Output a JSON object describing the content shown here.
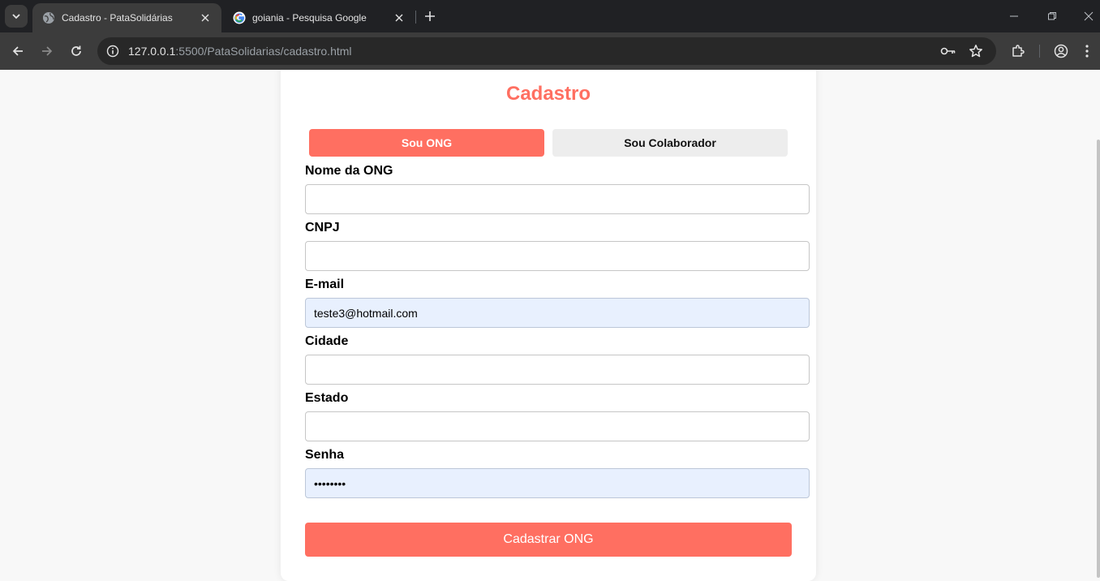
{
  "browser": {
    "tabs": [
      {
        "title": "Cadastro - PataSolidárias",
        "active": true
      },
      {
        "title": "goiania - Pesquisa Google",
        "active": false
      }
    ],
    "url_host": "127.0.0.1",
    "url_rest": ":5500/PataSolidarias/cadastro.html"
  },
  "page": {
    "title": "Cadastro",
    "toggle": {
      "ong_label": "Sou ONG",
      "colaborador_label": "Sou Colaborador",
      "selected": "ong"
    },
    "fields": {
      "nome_label": "Nome da ONG",
      "nome_value": "",
      "cnpj_label": "CNPJ",
      "cnpj_value": "",
      "email_label": "E-mail",
      "email_value": "teste3@hotmail.com",
      "cidade_label": "Cidade",
      "cidade_value": "",
      "estado_label": "Estado",
      "estado_value": "",
      "senha_label": "Senha",
      "senha_value": "••••••••"
    },
    "submit_label": "Cadastrar ONG"
  },
  "colors": {
    "accent": "#ff6f61",
    "autofill": "#e8f0fe",
    "toggle_off": "#ededed"
  },
  "icons": [
    "tab-search-icon",
    "globe-icon",
    "google-icon",
    "close-icon",
    "plus-icon",
    "minimize-icon",
    "restore-icon",
    "back-icon",
    "forward-icon",
    "reload-icon",
    "info-icon",
    "key-icon",
    "star-icon",
    "extensions-icon",
    "profile-icon",
    "menu-icon"
  ]
}
